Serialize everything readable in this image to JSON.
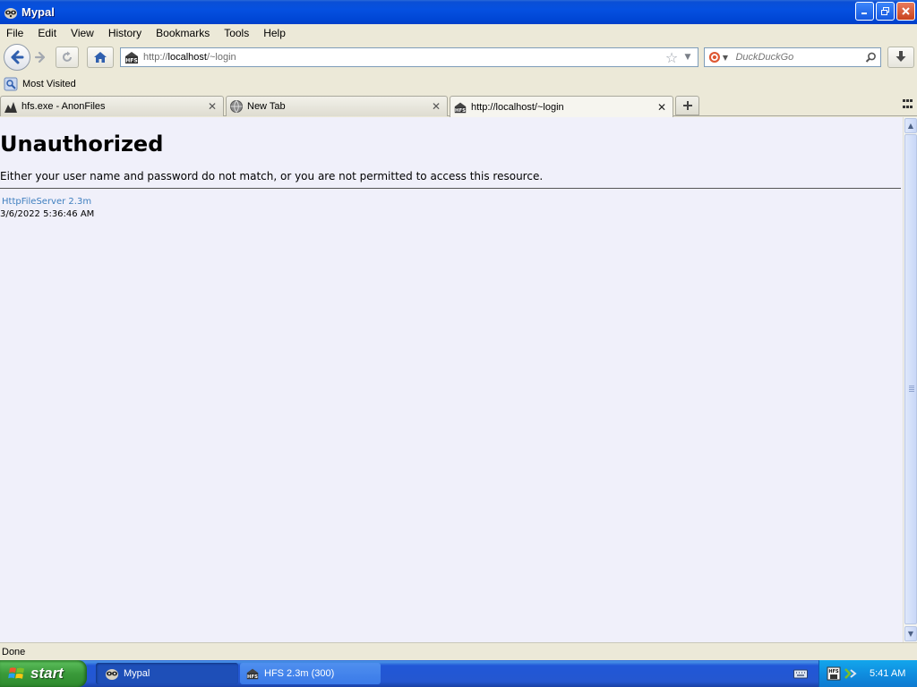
{
  "window": {
    "title": "Mypal"
  },
  "menu": [
    {
      "label": "File"
    },
    {
      "label": "Edit"
    },
    {
      "label": "View"
    },
    {
      "label": "History"
    },
    {
      "label": "Bookmarks"
    },
    {
      "label": "Tools"
    },
    {
      "label": "Help"
    }
  ],
  "urlbar": {
    "prefix": "http://",
    "host": "localhost",
    "path": "/~login"
  },
  "search": {
    "placeholder": "DuckDuckGo"
  },
  "bookmarks": {
    "most_visited": "Most Visited"
  },
  "tabs": [
    {
      "label": "hfs.exe - AnonFiles"
    },
    {
      "label": "New Tab"
    },
    {
      "label": "http://localhost/~login"
    }
  ],
  "page": {
    "heading": "Unauthorized",
    "message": "Either your user name and password do not match, or you are not permitted to access this resource.",
    "server_link": "HttpFileServer 2.3m",
    "timestamp": "3/6/2022 5:36:46 AM"
  },
  "status": {
    "text": "Done"
  },
  "taskbar": {
    "start": "start",
    "tasks": [
      {
        "label": "Mypal"
      },
      {
        "label": "HFS 2.3m (300)"
      }
    ],
    "clock": "5:41 AM"
  },
  "colors": {
    "content_bg": "#f0f0fa",
    "link": "#3f7fbf",
    "titlebar": "#0550e0",
    "taskbar": "#2457d0",
    "start": "#3a9a3a"
  },
  "icons": [
    "mypal-icon",
    "back-arrow-icon",
    "forward-arrow-icon",
    "reload-icon",
    "home-icon",
    "hfs-icon",
    "star-icon",
    "duckduckgo-icon",
    "magnifier-icon",
    "download-icon",
    "most-visited-icon",
    "anonfiles-icon",
    "globe-icon",
    "plus-icon",
    "keyboard-icon",
    "windows-logo-icon"
  ]
}
